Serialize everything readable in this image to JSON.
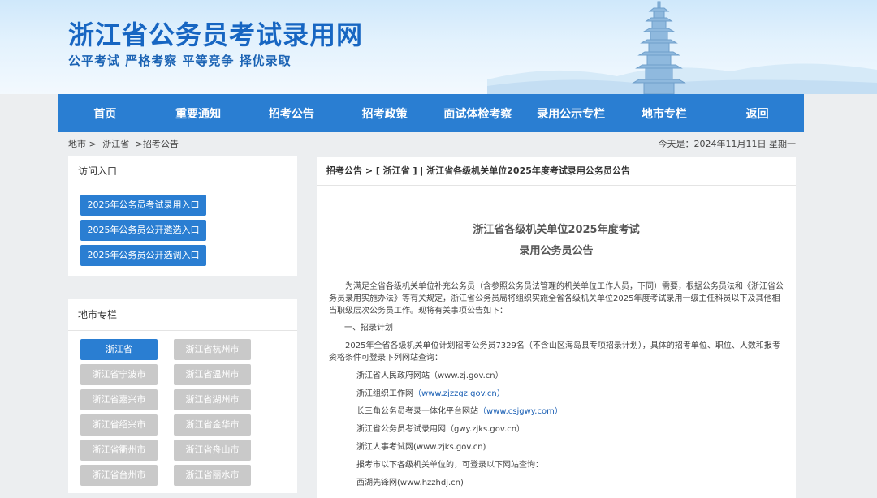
{
  "header": {
    "title": "浙江省公务员考试录用网",
    "slogan": "公平考试 严格考察 平等竞争 择优录取"
  },
  "nav": [
    "首页",
    "重要通知",
    "招考公告",
    "招考政策",
    "面试体检考察",
    "录用公示专栏",
    "地市专栏",
    "返回"
  ],
  "breadcrumb": [
    "地市 >",
    "浙江省",
    ">招考公告"
  ],
  "today": "今天是：2024年11月11日 星期一",
  "access": {
    "heading": "访问入口",
    "buttons": [
      "2025年公务员考试录用入口",
      "2025年公务员公开遴选入口",
      "2025年公务员公开选调入口"
    ]
  },
  "cities": {
    "heading": "地市专栏",
    "items": [
      "浙江省",
      "浙江省杭州市",
      "浙江省宁波市",
      "浙江省温州市",
      "浙江省嘉兴市",
      "浙江省湖州市",
      "浙江省绍兴市",
      "浙江省金华市",
      "浙江省衢州市",
      "浙江省舟山市",
      "浙江省台州市",
      "浙江省丽水市"
    ]
  },
  "article": {
    "breadcrumb": "招考公告 > [ 浙江省 ] | 浙江省各级机关单位2025年度考试录用公务员公告",
    "title_line1": "浙江省各级机关单位2025年度考试",
    "title_line2": "录用公务员公告",
    "intro": "为满足全省各级机关单位补充公务员（含参照公务员法管理的机关单位工作人员，下同）需要，根据公务员法和《浙江省公务员录用实施办法》等有关规定，浙江省公务员局将组织实施全省各级机关单位2025年度考试录用一级主任科员以下及其他相当职级层次公务员工作。现将有关事项公告如下：",
    "section1": "一、招录计划",
    "plan": "2025年全省各级机关单位计划招考公务员7329名（不含山区海岛县专项招录计划），具体的招考单位、职位、人数和报考资格条件可登录下列网站查询：",
    "sites": [
      {
        "name": "浙江省人民政府网站",
        "url": "（www.zj.gov.cn）",
        "link": false
      },
      {
        "name": "浙江组织工作网",
        "url": "（www.zjzzgz.gov.cn）",
        "link": true
      },
      {
        "name": "长三角公务员考录一体化平台网站",
        "url": "（www.csjgwy.com）",
        "link": true
      },
      {
        "name": "浙江省公务员考试录用网",
        "url": "（gwy.zjks.gov.cn）",
        "link": false
      },
      {
        "name": "浙江人事考试网",
        "url": "(www.zjks.gov.cn)",
        "link": false
      }
    ],
    "city_note": "报考市以下各级机关单位的，可登录以下网站查询：",
    "city_site": "西湖先锋网(www.hzzhdj.cn)"
  }
}
